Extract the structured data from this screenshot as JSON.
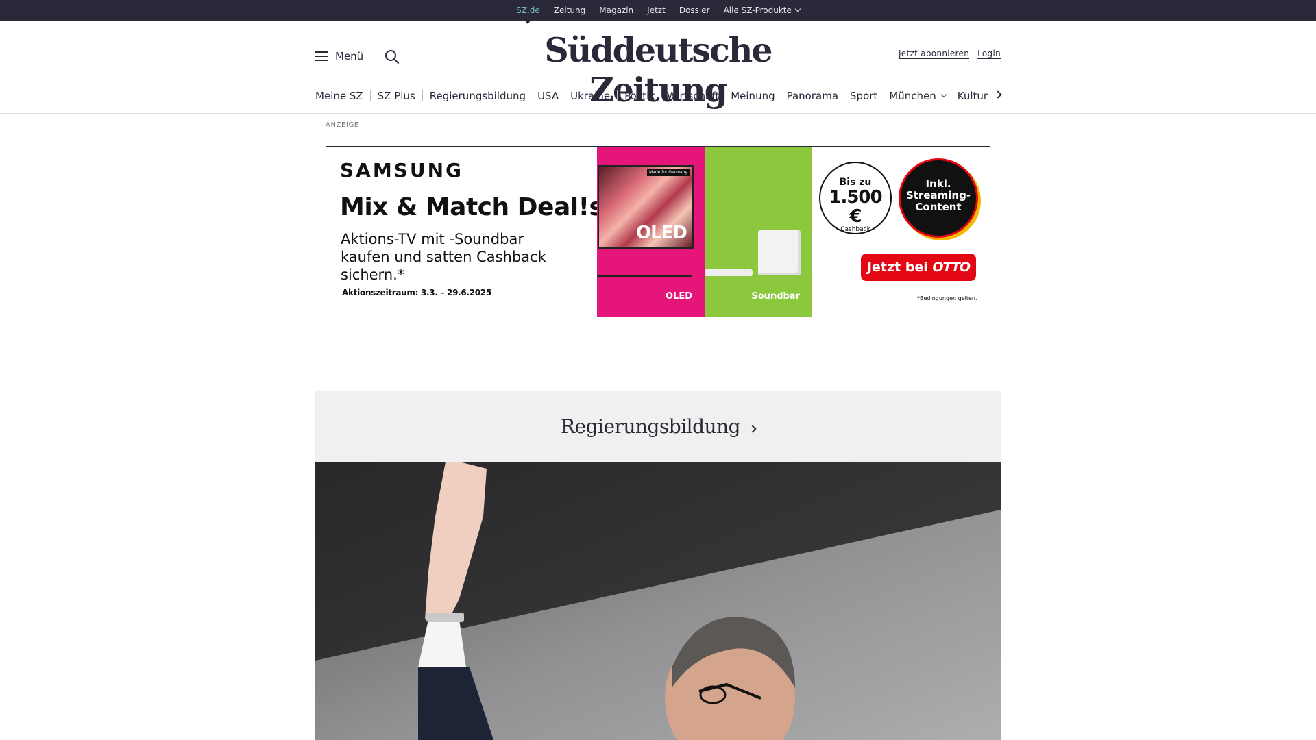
{
  "topbar": {
    "items": [
      {
        "label": "SZ.de",
        "active": true
      },
      {
        "label": "Zeitung"
      },
      {
        "label": "Magazin"
      },
      {
        "label": "Jetzt"
      },
      {
        "label": "Dossier"
      },
      {
        "label": "Alle SZ-Produkte",
        "dropdown": true
      }
    ]
  },
  "header": {
    "menu_label": "Menü",
    "menu_icon": "hamburger-icon",
    "search_icon": "search-icon",
    "logo": "Süddeutsche Zeitung",
    "subscribe_label": "Jetzt abonnieren",
    "login_label": "Login"
  },
  "nav": {
    "items": [
      "Meine SZ",
      "SZ Plus",
      "Regierungsbildung",
      "USA",
      "Ukraine",
      "Politik",
      "Wirtschaft",
      "Meinung",
      "Panorama",
      "Sport",
      "München",
      "Kultur"
    ]
  },
  "ad": {
    "label": "ANZEIGE",
    "brand": "SAMSUNG",
    "headline": "Mix & Match Deal!s",
    "copy": "Aktions-TV mit -Soundbar kaufen und satten Cashback sichern.*",
    "period": "Aktionszeitraum: 3.3. – 29.6.2025",
    "tv_badge": "Made for Germany",
    "tv_text": "OLED",
    "panel1_caption": "OLED",
    "panel2_caption": "Soundbar",
    "cashback_pre": "Bis zu",
    "cashback_amount": "1.500 €",
    "cashback_post": "Cashback",
    "streaming": "Inkl. Streaming-Content",
    "cta_prefix": "Jetzt bei",
    "cta_brand": "OTTO",
    "fineprint": "*Bedingungen gelten.",
    "colors": {
      "pink": "#e5157a",
      "green": "#8cc83e",
      "otto_red": "#e30613"
    }
  },
  "topic": {
    "title": "Regierungsbildung"
  },
  "colors": {
    "dark": "#29293a",
    "active_link": "#71b7c4",
    "topic_bg": "#f0f0f0"
  }
}
